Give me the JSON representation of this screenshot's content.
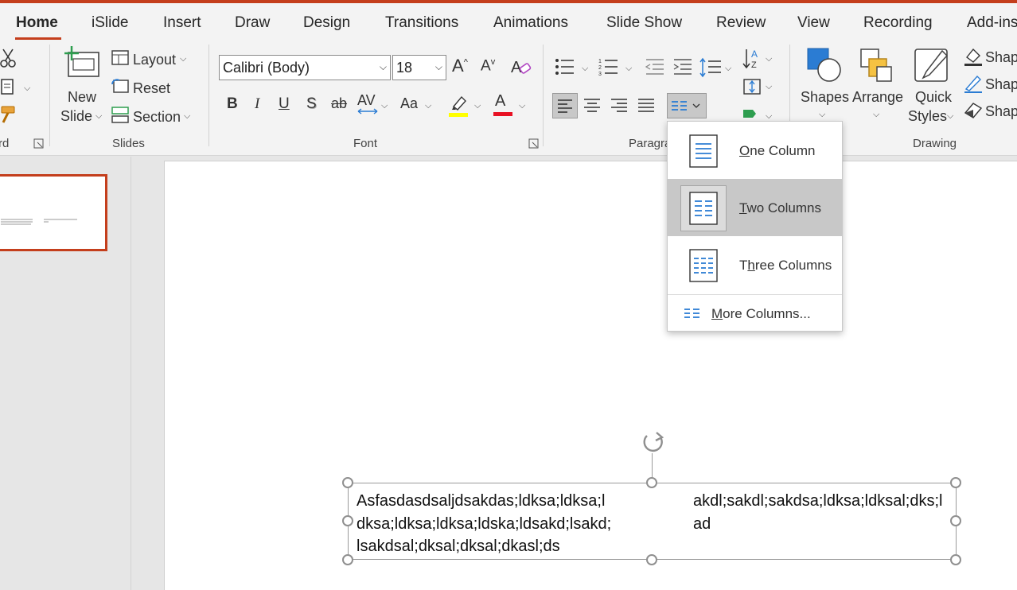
{
  "tabs": [
    {
      "label": "Home",
      "active": true
    },
    {
      "label": "iSlide"
    },
    {
      "label": "Insert"
    },
    {
      "label": "Draw"
    },
    {
      "label": "Design"
    },
    {
      "label": "Transitions"
    },
    {
      "label": "Animations"
    },
    {
      "label": "Slide Show"
    },
    {
      "label": "Review"
    },
    {
      "label": "View"
    },
    {
      "label": "Recording"
    },
    {
      "label": "Add-ins"
    }
  ],
  "ribbon": {
    "clipboard": {
      "label": "rd"
    },
    "slides": {
      "label": "Slides",
      "new_slide_line1": "New",
      "new_slide_line2": "Slide",
      "layout": "Layout",
      "reset": "Reset",
      "section": "Section"
    },
    "font": {
      "label": "Font",
      "family": "Calibri (Body)",
      "size": "18",
      "bold": "B",
      "italic": "I",
      "underline": "U",
      "shadow": "S",
      "strike": "ab",
      "spacing": "AV",
      "case": "Aa",
      "grow": "A",
      "shrink": "A",
      "color_letter": "A"
    },
    "paragraph": {
      "label": "Paragra"
    },
    "drawing": {
      "label": "Drawing",
      "shapes": "Shapes",
      "arrange": "Arrange",
      "quick_styles_line1": "Quick",
      "quick_styles_line2": "Styles",
      "shape_fill": "Shap",
      "shape_outline": "Shap",
      "shape_effects": "Shap"
    }
  },
  "columns_menu": {
    "items": [
      {
        "pre": "",
        "key": "O",
        "post": "ne Column"
      },
      {
        "pre": "",
        "key": "T",
        "post": "wo Columns"
      },
      {
        "pre": "T",
        "key": "h",
        "post": "ree Columns"
      }
    ],
    "more": {
      "pre": "",
      "key": "M",
      "post": "ore Columns..."
    }
  },
  "textbox": {
    "col1": "Asfasdasdsaljdsakdas;ldksa;ldksa;ldksa;ldksa;ldksa;ldska;ldsakd;lsakd;lsakdsal;dksal;dksal;dkasl;ds",
    "col2": "akdl;sakdl;sakdsa;ldksa;ldksal;dks;lad"
  },
  "colors": {
    "accent": "#c43e1c",
    "highlight": "#ffff00",
    "font_color": "#e81123",
    "icon_blue": "#2b7cd3"
  }
}
